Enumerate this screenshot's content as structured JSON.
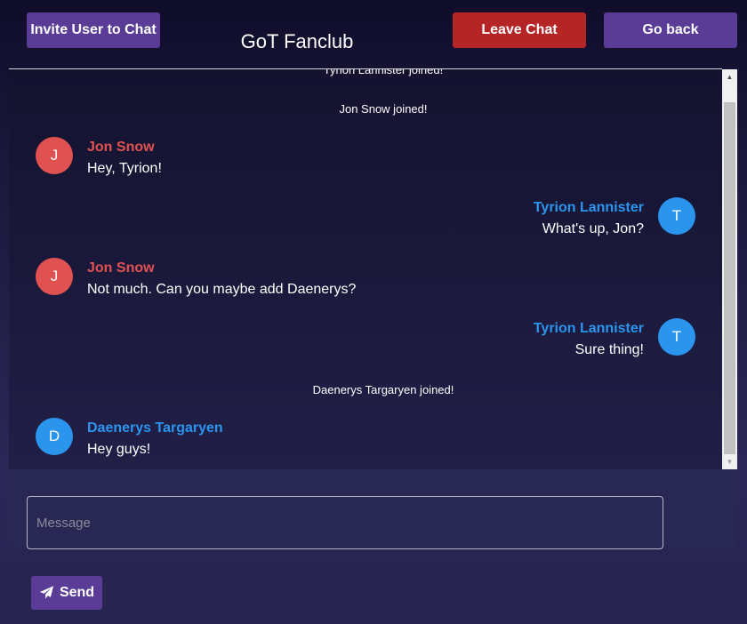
{
  "header": {
    "invite_label": "Invite User to Chat",
    "title": "GoT Fanclub",
    "leave_label": "Leave Chat",
    "back_label": "Go back"
  },
  "chat": {
    "partial_system_message": "Tyrion Lannister joined!",
    "messages": [
      {
        "type": "system",
        "text": "Jon Snow joined!"
      },
      {
        "type": "message",
        "sender": "Jon Snow",
        "initial": "J",
        "text": "Hey, Tyrion!",
        "side": "left"
      },
      {
        "type": "message",
        "sender": "Tyrion Lannister",
        "initial": "T",
        "text": "What's up, Jon?",
        "side": "right"
      },
      {
        "type": "message",
        "sender": "Jon Snow",
        "initial": "J",
        "text": "Not much. Can you maybe add Daenerys?",
        "side": "left"
      },
      {
        "type": "message",
        "sender": "Tyrion Lannister",
        "initial": "T",
        "text": "Sure thing!",
        "side": "right"
      },
      {
        "type": "system",
        "text": "Daenerys Targaryen joined!"
      },
      {
        "type": "message",
        "sender": "Daenerys Targaryen",
        "initial": "D",
        "text": "Hey guys!",
        "side": "left"
      }
    ]
  },
  "composer": {
    "placeholder": "Message",
    "value": "",
    "send_label": "Send",
    "send_icon": "paper-plane-icon"
  },
  "colors": {
    "accent_purple": "#5a3c97",
    "danger_red": "#b52525",
    "avatar_red": "#e05252",
    "avatar_blue": "#2b95ee"
  }
}
